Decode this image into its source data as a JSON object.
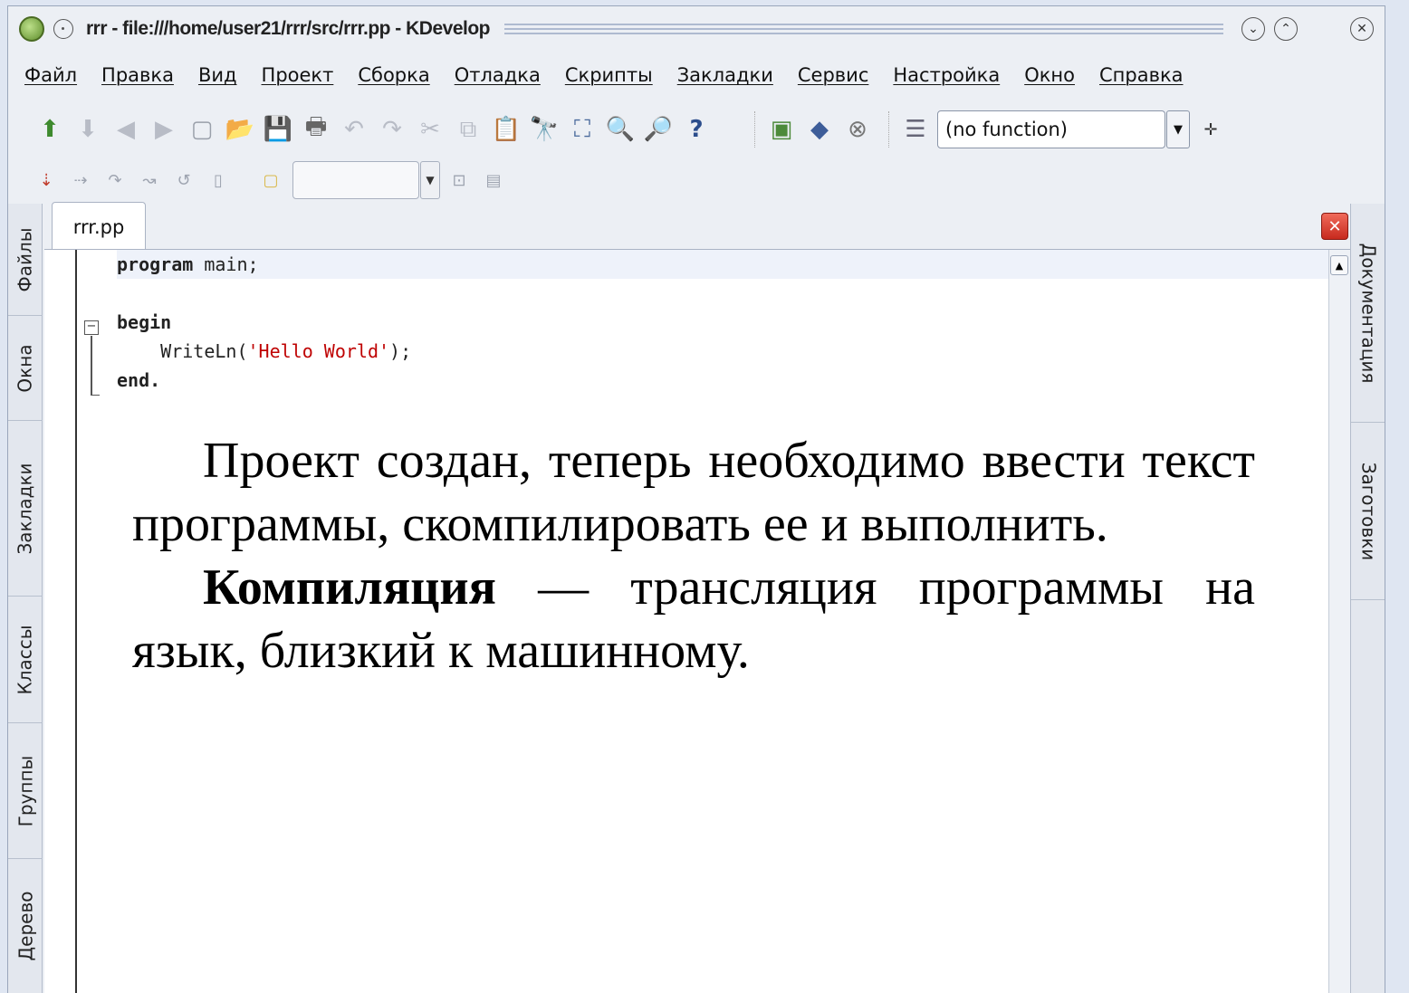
{
  "window": {
    "title": "rrr - file:///home/user21/rrr/src/rrr.pp - KDevelop"
  },
  "menu": [
    "Файл",
    "Правка",
    "Вид",
    "Проект",
    "Сборка",
    "Отладка",
    "Скрипты",
    "Закладки",
    "Сервис",
    "Настройка",
    "Окно",
    "Справка"
  ],
  "toolbar": {
    "function_combo": "(no function)"
  },
  "left_tabs": [
    "Файлы",
    "Окна",
    "Закладки",
    "Классы",
    "Группы",
    "Дерево"
  ],
  "right_tabs": [
    "Документация",
    "Заготовки"
  ],
  "editor": {
    "tab_label": "rrr.pp",
    "code": {
      "line1_kw": "program",
      "line1_rest": " main;",
      "line3_kw": "begin",
      "line4_pre": "    WriteLn(",
      "line4_str": "'Hello World'",
      "line4_post": ");",
      "line5_kw": "end."
    }
  },
  "overlay": {
    "p1": "Проект создан, теперь необходимо ввести текст программы, скомпилировать ее и выполнить.",
    "p2_bold": "Компиляция",
    "p2_rest": " — трансляция программы на язык, близкий к машинному."
  }
}
